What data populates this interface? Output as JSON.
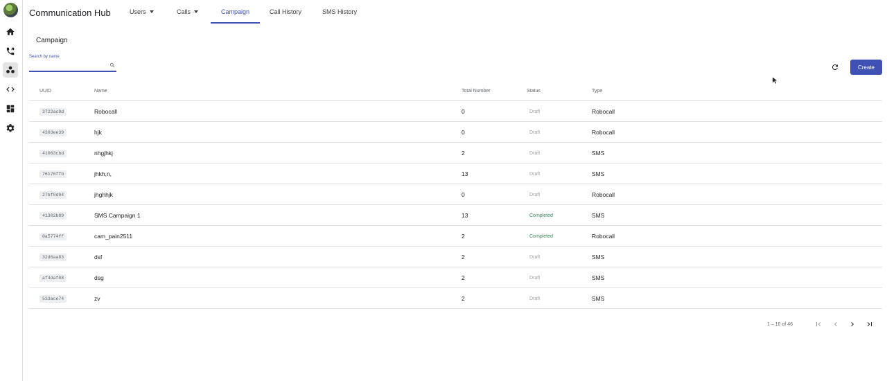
{
  "app": {
    "title": "Communication Hub"
  },
  "nav": {
    "tabs": [
      {
        "label": "Users",
        "has_dropdown": true
      },
      {
        "label": "Calls",
        "has_dropdown": true
      },
      {
        "label": "Campaign",
        "active": true
      },
      {
        "label": "Call History"
      },
      {
        "label": "SMS History"
      }
    ]
  },
  "sidebar": {
    "icons": [
      "home-icon",
      "phone-icon",
      "campaign-icon",
      "code-icon",
      "dashboard-icon",
      "settings-icon"
    ],
    "active": "campaign-icon"
  },
  "page": {
    "title": "Campaign"
  },
  "search": {
    "label": "Search by name",
    "value": "",
    "placeholder": ""
  },
  "actions": {
    "create_label": "Create"
  },
  "table": {
    "columns": {
      "uuid": "UUID",
      "name": "Name",
      "total": "Total Number",
      "status": "Status",
      "type": "Type"
    },
    "rows": [
      {
        "uuid": "3722ac9d",
        "name": "Robocall",
        "total": "0",
        "status": "Draft",
        "type": "Robocall"
      },
      {
        "uuid": "4303ee39",
        "name": "hjk",
        "total": "0",
        "status": "Draft",
        "type": "Robocall"
      },
      {
        "uuid": "41063cbd",
        "name": "nhgjhkj",
        "total": "2",
        "status": "Draft",
        "type": "SMS"
      },
      {
        "uuid": "76176ffb",
        "name": "jhkh,n,",
        "total": "13",
        "status": "Draft",
        "type": "SMS"
      },
      {
        "uuid": "27bf0d94",
        "name": "jhghhjk",
        "total": "0",
        "status": "Draft",
        "type": "Robocall"
      },
      {
        "uuid": "41302b89",
        "name": "SMS Campaign 1",
        "total": "13",
        "status": "Completed",
        "type": "SMS"
      },
      {
        "uuid": "0a5774ff",
        "name": "cam_pain2511",
        "total": "2",
        "status": "Completed",
        "type": "Robocall"
      },
      {
        "uuid": "32d6aa83",
        "name": "dsf",
        "total": "2",
        "status": "Draft",
        "type": "SMS"
      },
      {
        "uuid": "af4daf88",
        "name": "dsg",
        "total": "2",
        "status": "Draft",
        "type": "SMS"
      },
      {
        "uuid": "533ace74",
        "name": "zv",
        "total": "2",
        "status": "Draft",
        "type": "SMS"
      }
    ]
  },
  "pagination": {
    "range_label": "1 – 10 of 46"
  },
  "colors": {
    "accent": "#3f51b5",
    "completed": "#2e8b57",
    "draft": "#9e9e9e"
  }
}
